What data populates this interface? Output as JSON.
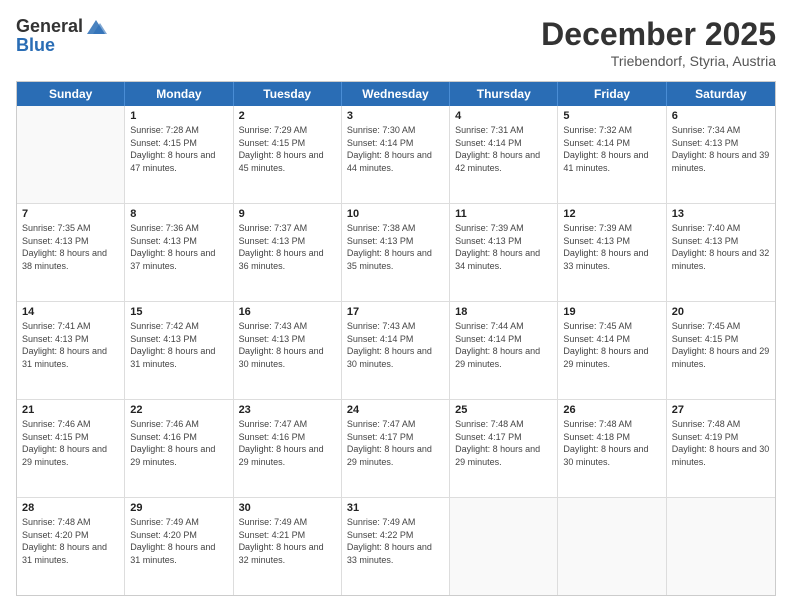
{
  "header": {
    "logo_general": "General",
    "logo_blue": "Blue",
    "month_title": "December 2025",
    "location": "Triebendorf, Styria, Austria"
  },
  "days_of_week": [
    "Sunday",
    "Monday",
    "Tuesday",
    "Wednesday",
    "Thursday",
    "Friday",
    "Saturday"
  ],
  "weeks": [
    [
      {
        "day": "",
        "empty": true
      },
      {
        "day": "1",
        "sunrise": "7:28 AM",
        "sunset": "4:15 PM",
        "daylight": "8 hours and 47 minutes."
      },
      {
        "day": "2",
        "sunrise": "7:29 AM",
        "sunset": "4:15 PM",
        "daylight": "8 hours and 45 minutes."
      },
      {
        "day": "3",
        "sunrise": "7:30 AM",
        "sunset": "4:14 PM",
        "daylight": "8 hours and 44 minutes."
      },
      {
        "day": "4",
        "sunrise": "7:31 AM",
        "sunset": "4:14 PM",
        "daylight": "8 hours and 42 minutes."
      },
      {
        "day": "5",
        "sunrise": "7:32 AM",
        "sunset": "4:14 PM",
        "daylight": "8 hours and 41 minutes."
      },
      {
        "day": "6",
        "sunrise": "7:34 AM",
        "sunset": "4:13 PM",
        "daylight": "8 hours and 39 minutes."
      }
    ],
    [
      {
        "day": "7",
        "sunrise": "7:35 AM",
        "sunset": "4:13 PM",
        "daylight": "8 hours and 38 minutes."
      },
      {
        "day": "8",
        "sunrise": "7:36 AM",
        "sunset": "4:13 PM",
        "daylight": "8 hours and 37 minutes."
      },
      {
        "day": "9",
        "sunrise": "7:37 AM",
        "sunset": "4:13 PM",
        "daylight": "8 hours and 36 minutes."
      },
      {
        "day": "10",
        "sunrise": "7:38 AM",
        "sunset": "4:13 PM",
        "daylight": "8 hours and 35 minutes."
      },
      {
        "day": "11",
        "sunrise": "7:39 AM",
        "sunset": "4:13 PM",
        "daylight": "8 hours and 34 minutes."
      },
      {
        "day": "12",
        "sunrise": "7:39 AM",
        "sunset": "4:13 PM",
        "daylight": "8 hours and 33 minutes."
      },
      {
        "day": "13",
        "sunrise": "7:40 AM",
        "sunset": "4:13 PM",
        "daylight": "8 hours and 32 minutes."
      }
    ],
    [
      {
        "day": "14",
        "sunrise": "7:41 AM",
        "sunset": "4:13 PM",
        "daylight": "8 hours and 31 minutes."
      },
      {
        "day": "15",
        "sunrise": "7:42 AM",
        "sunset": "4:13 PM",
        "daylight": "8 hours and 31 minutes."
      },
      {
        "day": "16",
        "sunrise": "7:43 AM",
        "sunset": "4:13 PM",
        "daylight": "8 hours and 30 minutes."
      },
      {
        "day": "17",
        "sunrise": "7:43 AM",
        "sunset": "4:14 PM",
        "daylight": "8 hours and 30 minutes."
      },
      {
        "day": "18",
        "sunrise": "7:44 AM",
        "sunset": "4:14 PM",
        "daylight": "8 hours and 29 minutes."
      },
      {
        "day": "19",
        "sunrise": "7:45 AM",
        "sunset": "4:14 PM",
        "daylight": "8 hours and 29 minutes."
      },
      {
        "day": "20",
        "sunrise": "7:45 AM",
        "sunset": "4:15 PM",
        "daylight": "8 hours and 29 minutes."
      }
    ],
    [
      {
        "day": "21",
        "sunrise": "7:46 AM",
        "sunset": "4:15 PM",
        "daylight": "8 hours and 29 minutes."
      },
      {
        "day": "22",
        "sunrise": "7:46 AM",
        "sunset": "4:16 PM",
        "daylight": "8 hours and 29 minutes."
      },
      {
        "day": "23",
        "sunrise": "7:47 AM",
        "sunset": "4:16 PM",
        "daylight": "8 hours and 29 minutes."
      },
      {
        "day": "24",
        "sunrise": "7:47 AM",
        "sunset": "4:17 PM",
        "daylight": "8 hours and 29 minutes."
      },
      {
        "day": "25",
        "sunrise": "7:48 AM",
        "sunset": "4:17 PM",
        "daylight": "8 hours and 29 minutes."
      },
      {
        "day": "26",
        "sunrise": "7:48 AM",
        "sunset": "4:18 PM",
        "daylight": "8 hours and 30 minutes."
      },
      {
        "day": "27",
        "sunrise": "7:48 AM",
        "sunset": "4:19 PM",
        "daylight": "8 hours and 30 minutes."
      }
    ],
    [
      {
        "day": "28",
        "sunrise": "7:48 AM",
        "sunset": "4:20 PM",
        "daylight": "8 hours and 31 minutes."
      },
      {
        "day": "29",
        "sunrise": "7:49 AM",
        "sunset": "4:20 PM",
        "daylight": "8 hours and 31 minutes."
      },
      {
        "day": "30",
        "sunrise": "7:49 AM",
        "sunset": "4:21 PM",
        "daylight": "8 hours and 32 minutes."
      },
      {
        "day": "31",
        "sunrise": "7:49 AM",
        "sunset": "4:22 PM",
        "daylight": "8 hours and 33 minutes."
      },
      {
        "day": "",
        "empty": true
      },
      {
        "day": "",
        "empty": true
      },
      {
        "day": "",
        "empty": true
      }
    ]
  ],
  "labels": {
    "sunrise": "Sunrise:",
    "sunset": "Sunset:",
    "daylight": "Daylight:"
  }
}
